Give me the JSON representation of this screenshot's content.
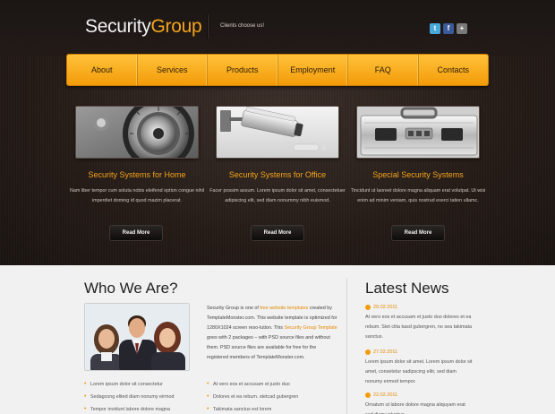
{
  "header": {
    "logo_primary": "Security",
    "logo_accent": "Group",
    "slogan": "Clients choose us!",
    "social": [
      {
        "name": "twitter-icon",
        "glyph": "t"
      },
      {
        "name": "facebook-icon",
        "glyph": "f"
      },
      {
        "name": "plus-icon",
        "glyph": "+"
      }
    ]
  },
  "nav": {
    "items": [
      "About",
      "Services",
      "Products",
      "Employment",
      "FAQ",
      "Contacts"
    ]
  },
  "features": [
    {
      "title": "Security Systems for Home",
      "text": "Nam liber tempor cum soluta nobis eleifend option congue nihil imperdiet doming id quod mazim placerat.",
      "button": "Read More"
    },
    {
      "title": "Security Systems for Office",
      "text": "Facer possim assum. Lorem ipsum dolor sit amet, consectetuer adipiscing elit, sed diam nonummy nibh euismod.",
      "button": "Read More"
    },
    {
      "title": "Special Security Systems",
      "text": "Tincidunt ut laoreet dolore magna aliquam erat volutpat. Ut wisi enim ad minim veniam, quis nostrud exerci tation ullamc.",
      "button": "Read More"
    }
  ],
  "who": {
    "heading": "Who We Are?",
    "text_1": "Security Group is one of ",
    "link_1": "free website templates",
    "text_2": " created by TemplateMonster.com. This website template is optimized for 1280X1024 screen reso-lution. This ",
    "link_2": "Security Group Template",
    "text_3": " goes with 2 packages – with PSD source files and without them. PSD source files are available for free for the registered members of TemplateMonster.com.",
    "bullets_left": [
      "Lorem ipsum dolor sit consectetur",
      "Sedagcong elited diam nonumy eirmod",
      "Tempor invidunt labore dolore magna"
    ],
    "bullets_right": [
      "At vero eos et accusam et justo duo",
      "Dolores et ea rebum. stetcad gubergren",
      "Takimata sanctus est lorem"
    ]
  },
  "news": {
    "heading": "Latest News",
    "items": [
      {
        "date": "29.02.2011",
        "text": "At vero eos et accusam et justo duo dolores et ea rebum. Stet clita kasd gubergren, no sea takimata sanctus."
      },
      {
        "date": "27.02.2011",
        "text": "Lorem ipsum dolor sit amet. Lorem ipsum dolor sit amet, consetetur sadipscing elitr, sed diam nonumy eirmod tempor."
      },
      {
        "date": "22.02.2011",
        "text": "Ornatum ut labore dolore magna aliquyam erat sed diam voluptua."
      }
    ]
  },
  "colors": {
    "accent": "#f4a41c",
    "nav_gradient_top": "#ffc23a",
    "nav_gradient_bottom": "#f39b09",
    "dark_bg": "#241b17"
  }
}
